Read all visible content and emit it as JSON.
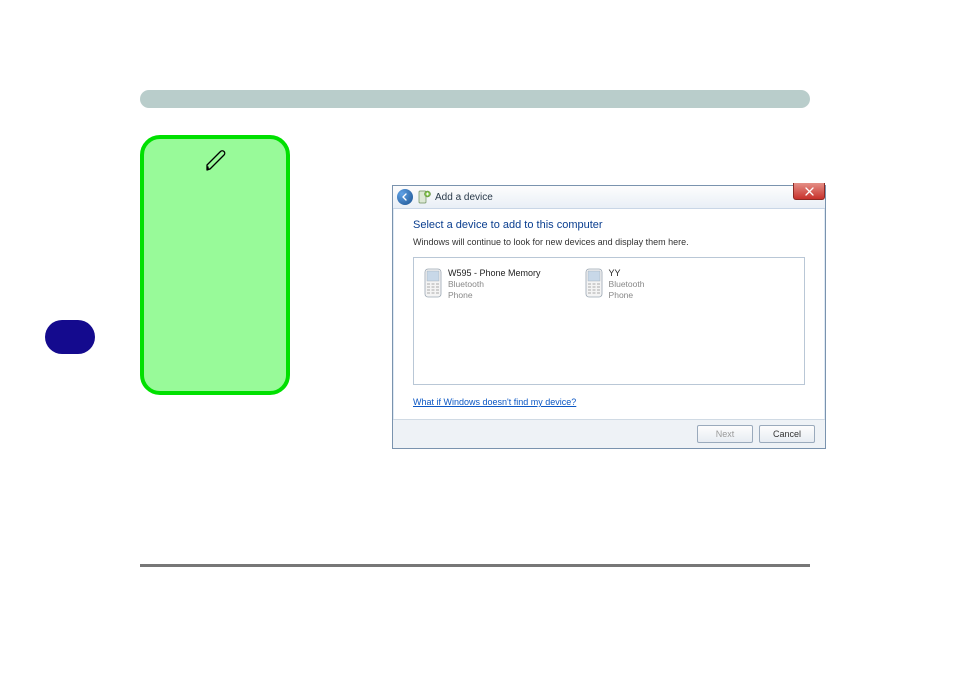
{
  "dialog": {
    "title": "Add a device",
    "heading": "Select a device to add to this computer",
    "subtext": "Windows will continue to look for new devices and display them here.",
    "helpLink": "What if Windows doesn't find my device?",
    "buttons": {
      "next": "Next",
      "cancel": "Cancel"
    },
    "devices": [
      {
        "name": "W595 - Phone Memory",
        "line2": "Bluetooth",
        "line3": "Phone"
      },
      {
        "name": "YY",
        "line2": "Bluetooth",
        "line3": "Phone"
      }
    ]
  }
}
